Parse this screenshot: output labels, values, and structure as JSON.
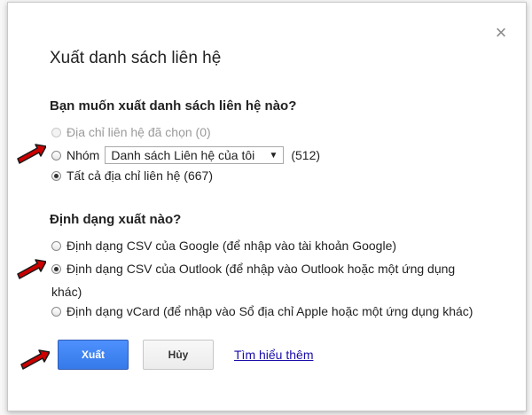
{
  "dialog": {
    "title": "Xuất danh sách liên hệ",
    "close_glyph": "×"
  },
  "section_contacts": {
    "heading": "Bạn muốn xuất danh sách liên hệ nào?",
    "options": [
      {
        "label": "Địa chỉ liên hệ đã chọn (0)",
        "checked": false,
        "disabled": true
      },
      {
        "label": "Nhóm",
        "checked": false,
        "disabled": false
      },
      {
        "label": "Tất cả địa chỉ liên hệ (667)",
        "checked": true,
        "disabled": false
      }
    ],
    "group_select": {
      "selected": "Danh sách Liên hệ của tôi",
      "count": "(512)"
    }
  },
  "section_format": {
    "heading": "Định dạng xuất nào?",
    "options": [
      {
        "label": "Định dạng CSV của Google (để nhập vào tài khoản Google)",
        "checked": false
      },
      {
        "label": "Định dạng CSV của Outlook (để nhập vào Outlook hoặc một ứng dụng",
        "checked": true
      },
      {
        "label": "Định dạng vCard (để nhập vào Sổ địa chỉ Apple hoặc một ứng dụng khác)",
        "checked": false
      }
    ],
    "outlook_wrap": "khác)"
  },
  "actions": {
    "export_label": "Xuất",
    "cancel_label": "Hủy",
    "learn_more_label": "Tìm hiểu thêm"
  },
  "colors": {
    "primary_button": "#4d90fe",
    "link": "#1a0dab",
    "arrow_red": "#cc0000"
  },
  "icons": {
    "close": "close-icon",
    "arrow": "pointer-arrow-icon",
    "dropdown": "chevron-down-icon"
  }
}
